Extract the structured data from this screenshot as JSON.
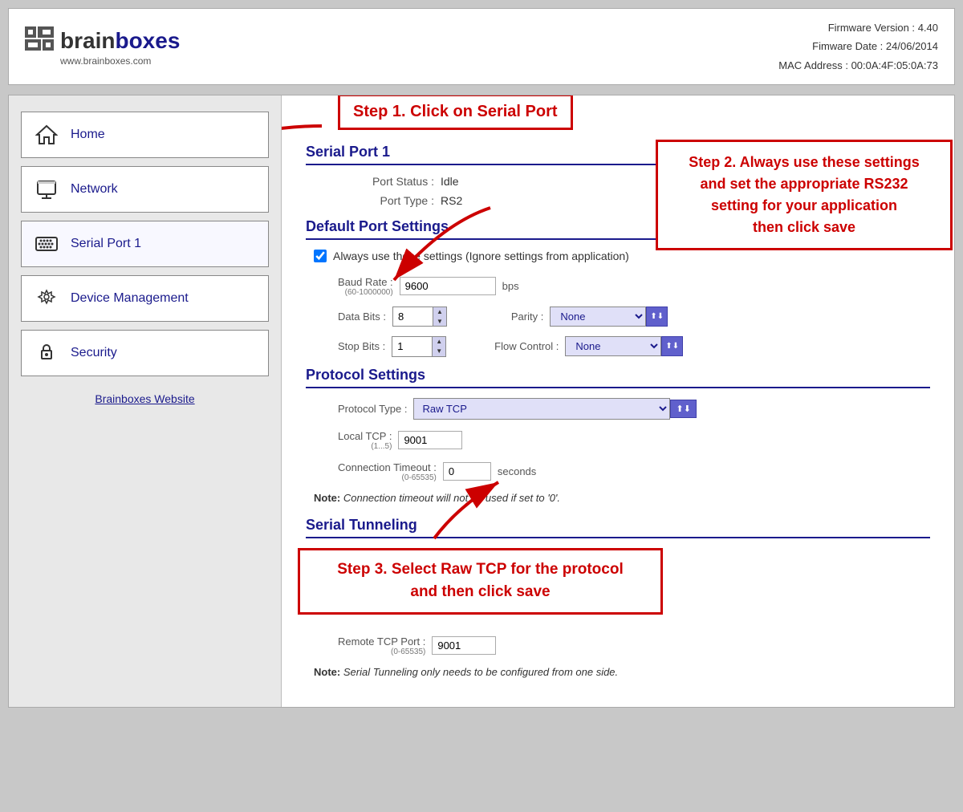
{
  "header": {
    "logo_brand": "brain",
    "logo_name": "boxes",
    "logo_url": "www.brainboxes.com",
    "firmware_label": "Firmware Version :",
    "firmware_value": "4.40",
    "firmware_date_label": "Fimware Date :",
    "firmware_date_value": "24/06/2014",
    "mac_label": "MAC Address :",
    "mac_value": "00:0A:4F:05:0A:73"
  },
  "sidebar": {
    "items": [
      {
        "id": "home",
        "label": "Home",
        "icon": "home"
      },
      {
        "id": "network",
        "label": "Network",
        "icon": "network"
      },
      {
        "id": "serial-port",
        "label": "Serial Port 1",
        "icon": "serial"
      },
      {
        "id": "device-mgmt",
        "label": "Device Management",
        "icon": "wrench"
      },
      {
        "id": "security",
        "label": "Security",
        "icon": "lock"
      }
    ],
    "external_link": "Brainboxes Website"
  },
  "steps": {
    "step1": "Step 1. Click on Serial Port",
    "step2": "Step 2. Always use these settings\nand set the appropriate RS232\nsetting for your application\nthen click save",
    "step3": "Step 3. Select Raw TCP for the protocol\nand then click save"
  },
  "content": {
    "serial_port_title": "Serial Port 1",
    "port_status_label": "Port Status :",
    "port_status_value": "Idle",
    "port_type_label": "Port Type :",
    "port_type_value": "RS2",
    "default_port_title": "Default Port Settings",
    "checkbox_label": "Always use these settings (Ignore settings from application)",
    "baud_rate_label": "Baud Rate :",
    "baud_rate_sub": "(60-1000000)",
    "baud_rate_value": "9600",
    "baud_rate_unit": "bps",
    "data_bits_label": "Data Bits :",
    "data_bits_value": "8",
    "parity_label": "Parity :",
    "parity_value": "None",
    "stop_bits_label": "Stop Bits :",
    "stop_bits_value": "1",
    "flow_control_label": "Flow Control :",
    "flow_control_value": "None",
    "protocol_title": "Protocol Settings",
    "protocol_type_label": "Protocol Type :",
    "protocol_type_value": "Raw TCP",
    "local_tc_label": "Local TC",
    "local_tc_sub": "(1...5)",
    "local_tc_value": "9001",
    "conn_timeout_label": "Connection Timeout :",
    "conn_timeout_sub": "(0-65535)",
    "conn_timeout_value": "0",
    "conn_timeout_unit": "seconds",
    "note1_bold": "Note:",
    "note1_text": " Connection timeout will not be used if set to '0'.",
    "serial_tunneling_title": "Serial Tunneling",
    "remote_tcp_label": "Remote TCP Port :",
    "remote_tcp_sub": "(0-65535)",
    "remote_tcp_value": "9001",
    "note2_bold": "Note:",
    "note2_text": " Serial Tunneling only needs to be configured from one side."
  }
}
